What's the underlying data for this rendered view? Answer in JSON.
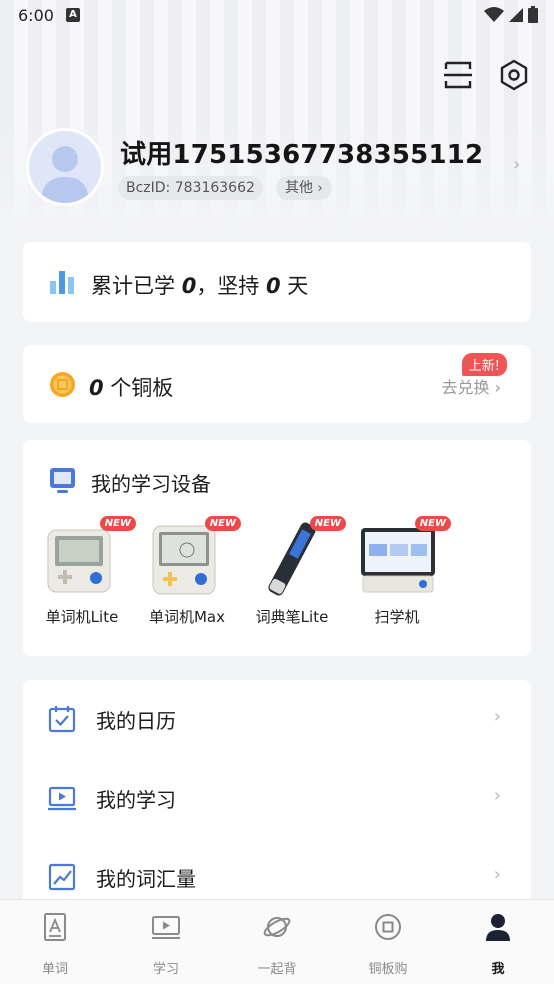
{
  "status_bar": {
    "time": "6:00",
    "indicator": "A"
  },
  "header": {
    "icons": [
      "scan-icon",
      "settings-icon"
    ]
  },
  "profile": {
    "username": "试用17515367738355112",
    "bcz_id": "BczID: 783163662",
    "other_label": "其他",
    "other_chevron": "›",
    "chevron": "›"
  },
  "stats": {
    "prefix": "累计已学 ",
    "days_learned": "0",
    "middle": "，坚持 ",
    "streak_days": "0",
    "suffix": " 天"
  },
  "coins": {
    "count": "0",
    "unit_label": " 个铜板",
    "exchange_label": "去兑换 ›",
    "new_badge": "上新!"
  },
  "devices": {
    "title": "我的学习设备",
    "badge": "NEW",
    "items": [
      {
        "label": "单词机Lite"
      },
      {
        "label": "单词机Max"
      },
      {
        "label": "词典笔Lite"
      },
      {
        "label": "扫学机"
      }
    ]
  },
  "menu": {
    "items": [
      {
        "label": "我的日历",
        "icon": "calendar-icon"
      },
      {
        "label": "我的学习",
        "icon": "play-screen-icon"
      },
      {
        "label": "我的词汇量",
        "icon": "chart-trend-icon"
      }
    ],
    "chevron": "›"
  },
  "tabbar": {
    "items": [
      {
        "label": "单词",
        "icon": "word-card-icon"
      },
      {
        "label": "学习",
        "icon": "video-icon"
      },
      {
        "label": "一起背",
        "icon": "planet-icon"
      },
      {
        "label": "铜板购",
        "icon": "coin-icon"
      },
      {
        "label": "我",
        "icon": "person-icon"
      }
    ],
    "active": "我"
  },
  "colors": {
    "accent_blue": "#4a79d9",
    "badge_red": "#f05454",
    "coin_orange": "#f5a623",
    "chart_blue": "#5aa8e8"
  }
}
